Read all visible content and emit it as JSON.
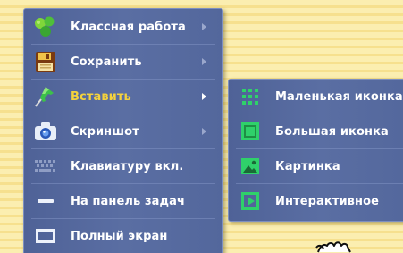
{
  "main_menu": {
    "items": [
      {
        "label": "Классная работа",
        "icon": "green-blobs-icon",
        "has_submenu": true,
        "active": false
      },
      {
        "label": "Сохранить",
        "icon": "floppy-disk-icon",
        "has_submenu": true,
        "active": false
      },
      {
        "label": "Вставить",
        "icon": "green-pushpin-icon",
        "has_submenu": true,
        "active": true
      },
      {
        "label": "Скриншот",
        "icon": "camera-icon",
        "has_submenu": true,
        "active": false
      },
      {
        "label": "Клавиатуру вкл.",
        "icon": "keyboard-icon",
        "has_submenu": false,
        "active": false
      },
      {
        "label": "На панель задач",
        "icon": "minimize-icon",
        "has_submenu": false,
        "active": false
      },
      {
        "label": "Полный экран",
        "icon": "fullscreen-icon",
        "has_submenu": false,
        "active": false
      }
    ]
  },
  "insert_submenu": {
    "items": [
      {
        "label": "Маленькая иконка",
        "icon": "small-icon-grid-icon"
      },
      {
        "label": "Большая иконка",
        "icon": "large-icon-square-icon"
      },
      {
        "label": "Картинка",
        "icon": "picture-icon"
      },
      {
        "label": "Интерактивное",
        "icon": "play-interactive-icon"
      }
    ]
  },
  "colors": {
    "menu_bg": "#5a6ea3",
    "active_label": "#f4d23c",
    "label": "#ffffff",
    "icon_green": "#2fd16a"
  }
}
